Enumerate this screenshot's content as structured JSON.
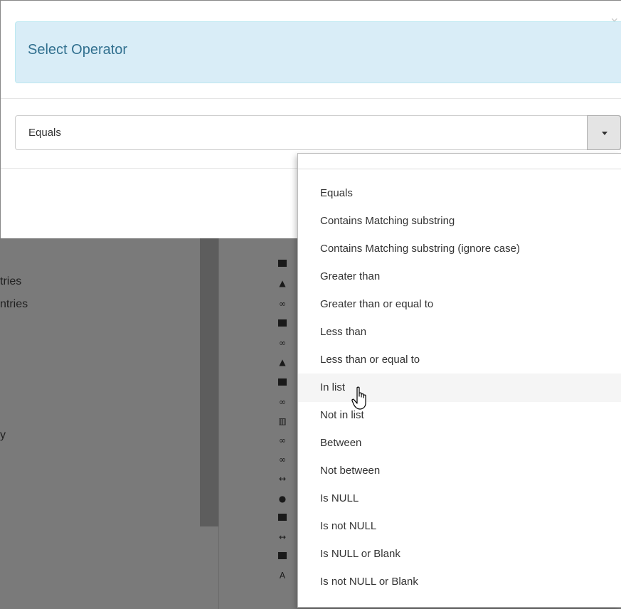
{
  "modal": {
    "title": "Select Operator",
    "close_glyph": "×",
    "select": {
      "value": "Equals"
    }
  },
  "background": {
    "texts": [
      "tries",
      "ntries",
      "y"
    ]
  },
  "dropdown": {
    "options": [
      "Equals",
      "Contains Matching substring",
      "Contains Matching substring (ignore case)",
      "Greater than",
      "Greater than or equal to",
      "Less than",
      "Less than or equal to",
      "In list",
      "Not in list",
      "Between",
      "Not between",
      "Is NULL",
      "Is not NULL",
      "Is NULL or Blank",
      "Is not NULL or Blank"
    ],
    "hovered": "In list"
  },
  "colors": {
    "alert_bg": "#d9edf7",
    "alert_text": "#31708f",
    "overlay": "#7a7a7a"
  }
}
